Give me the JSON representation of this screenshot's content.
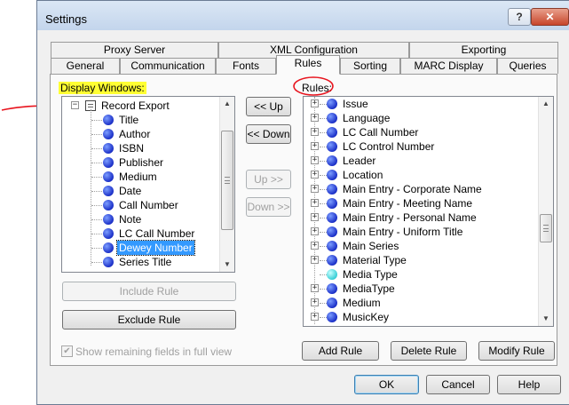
{
  "window": {
    "title": "Settings",
    "help_glyph": "?",
    "close_glyph": "✕"
  },
  "tabs": {
    "row1": [
      "Proxy Server",
      "XML Configuration",
      "Exporting"
    ],
    "row2": [
      "General",
      "Communication",
      "Fonts",
      "Rules",
      "Sorting",
      "MARC Display",
      "Queries"
    ],
    "active": "Rules"
  },
  "display_windows": {
    "label": "Display Windows:",
    "root": "Record Export",
    "items": [
      "Title",
      "Author",
      "ISBN",
      "Publisher",
      "Medium",
      "Date",
      "Call Number",
      "Note",
      "LC Call Number",
      "Dewey Number",
      "Series Title"
    ],
    "selected": "Dewey Number"
  },
  "move_buttons": {
    "up_left": "<< Up",
    "down_left": "<< Down",
    "up_right": "Up >>",
    "down_right": "Down >>"
  },
  "rules": {
    "label": "Rules:",
    "items": [
      "Issue",
      "Language",
      "LC Call Number",
      "LC Control Number",
      "Leader",
      "Location",
      "Main Entry - Corporate Name",
      "Main Entry - Meeting Name",
      "Main Entry - Personal Name",
      "Main Entry - Uniform Title",
      "Main Series",
      "Material Type",
      "Media Type",
      "MediaType",
      "Medium",
      "MusicKey"
    ]
  },
  "left_buttons": {
    "include": "Include Rule",
    "exclude": "Exclude Rule"
  },
  "show_remaining": {
    "label": "Show remaining fields in full view",
    "checked": true
  },
  "rule_buttons": {
    "add": "Add Rule",
    "delete": "Delete Rule",
    "modify": "Modify Rule"
  },
  "dialog_buttons": {
    "ok": "OK",
    "cancel": "Cancel",
    "help": "Help"
  },
  "colors": {
    "highlight": "#ffff33",
    "annotation": "#e8141e",
    "selection": "#3399ff",
    "node_dot": "#1a2fc8",
    "node_dot_alt": "#38cfd6"
  }
}
